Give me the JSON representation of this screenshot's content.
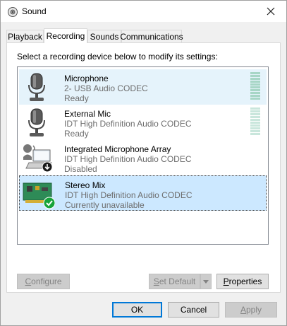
{
  "window": {
    "title": "Sound"
  },
  "tabs": [
    {
      "label": "Playback"
    },
    {
      "label": "Recording"
    },
    {
      "label": "Sounds"
    },
    {
      "label": "Communications"
    }
  ],
  "instruction": "Select a recording device below to modify its settings:",
  "devices": [
    {
      "name": "Microphone",
      "line1": "2- USB Audio CODEC",
      "line2": "Ready",
      "state": "highlight",
      "icon": "microphone-icon"
    },
    {
      "name": "External Mic",
      "line1": "IDT High Definition Audio CODEC",
      "line2": "Ready",
      "state": "normal",
      "icon": "microphone-icon"
    },
    {
      "name": "Integrated Microphone Array",
      "line1": "IDT High Definition Audio CODEC",
      "line2": "Disabled",
      "state": "normal",
      "icon": "laptop-microphone-disabled-icon"
    },
    {
      "name": "Stereo Mix",
      "line1": "IDT High Definition Audio CODEC",
      "line2": "Currently unavailable",
      "state": "selected",
      "icon": "sound-card-default-icon"
    }
  ],
  "buttons": {
    "configure_rest": "onfigure",
    "configure_mnemonic": "C",
    "set_default_mnemonic": "S",
    "set_default_rest": "et Default",
    "properties_mnemonic": "P",
    "properties_rest": "roperties",
    "ok": "OK",
    "cancel": "Cancel",
    "apply_mnemonic": "A",
    "apply_rest": "pply"
  },
  "colors": {
    "accent": "#0078d7",
    "selection": "#cce8ff",
    "hover": "#e5f3fb",
    "default_check": "#16a33a"
  }
}
